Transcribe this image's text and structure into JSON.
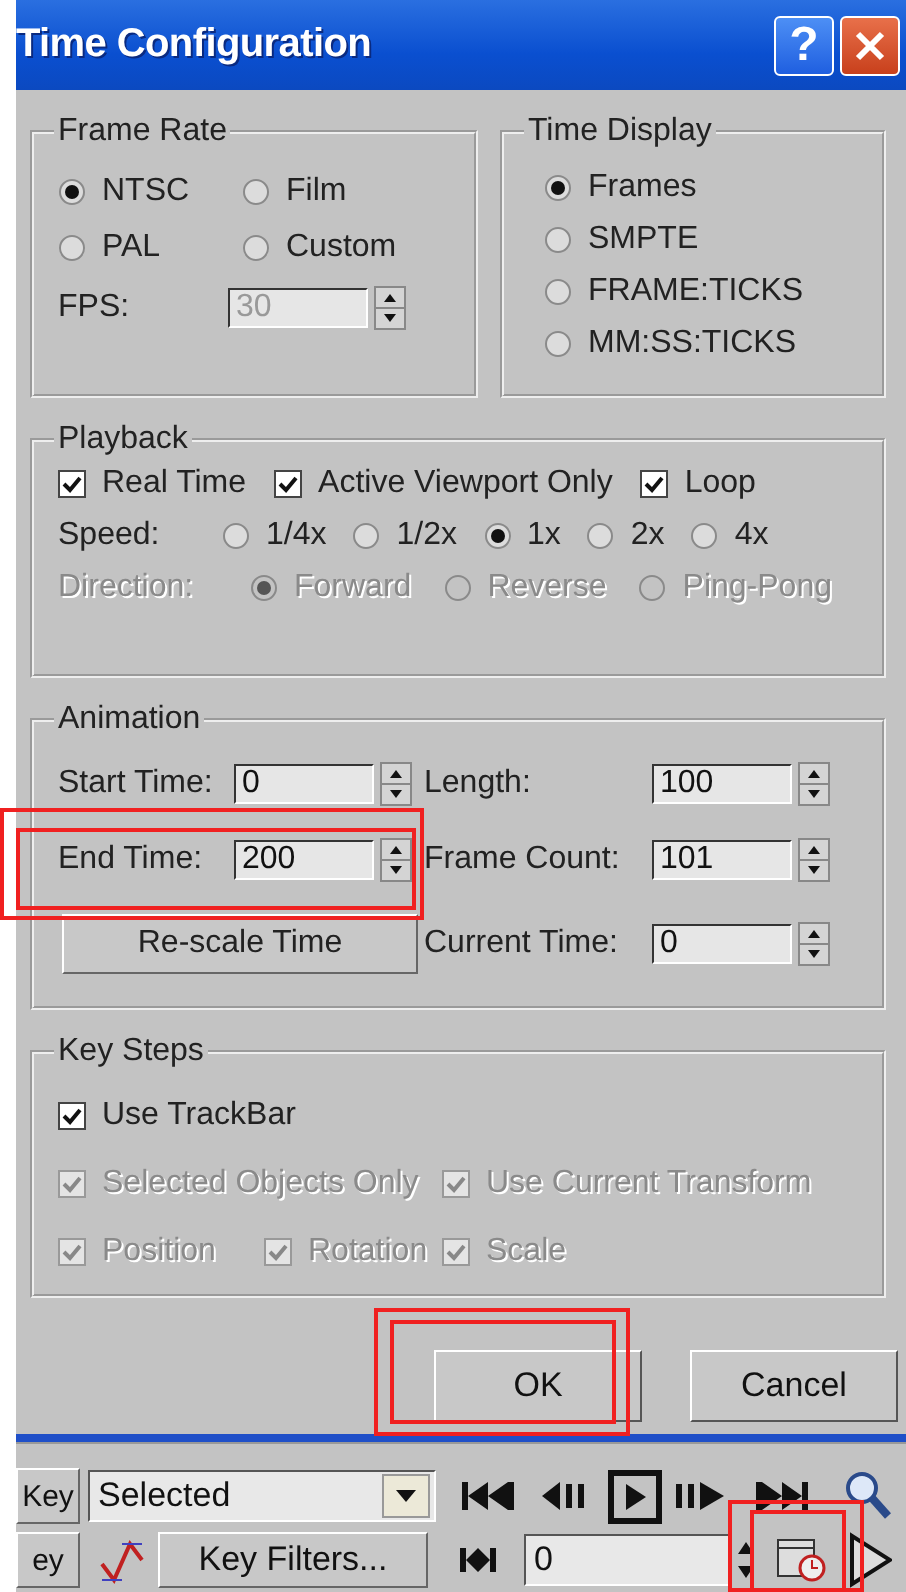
{
  "window": {
    "title": "Time Configuration",
    "help_button": "?"
  },
  "frame_rate": {
    "label": "Frame Rate",
    "options": [
      {
        "label": "NTSC",
        "selected": true
      },
      {
        "label": "Film",
        "selected": false
      },
      {
        "label": "PAL",
        "selected": false
      },
      {
        "label": "Custom",
        "selected": false
      }
    ],
    "fps_label": "FPS:",
    "fps_value": "30",
    "fps_disabled": true
  },
  "time_display": {
    "label": "Time Display",
    "options": [
      {
        "label": "Frames",
        "selected": true
      },
      {
        "label": "SMPTE",
        "selected": false
      },
      {
        "label": "FRAME:TICKS",
        "selected": false
      },
      {
        "label": "MM:SS:TICKS",
        "selected": false
      }
    ]
  },
  "playback": {
    "label": "Playback",
    "checks": [
      {
        "label": "Real Time",
        "checked": true
      },
      {
        "label": "Active Viewport Only",
        "checked": true
      },
      {
        "label": "Loop",
        "checked": true
      }
    ],
    "speed_label": "Speed:",
    "speeds": [
      {
        "label": "1/4x",
        "selected": false
      },
      {
        "label": "1/2x",
        "selected": false
      },
      {
        "label": "1x",
        "selected": true
      },
      {
        "label": "2x",
        "selected": false
      },
      {
        "label": "4x",
        "selected": false
      }
    ],
    "direction_label": "Direction:",
    "direction_disabled": true,
    "directions": [
      {
        "label": "Forward",
        "selected": true
      },
      {
        "label": "Reverse",
        "selected": false
      },
      {
        "label": "Ping-Pong",
        "selected": false
      }
    ]
  },
  "animation": {
    "label": "Animation",
    "fields": [
      {
        "label": "Start Time:",
        "value": "0"
      },
      {
        "label": "Length:",
        "value": "100"
      },
      {
        "label": "End Time:",
        "value": "200"
      },
      {
        "label": "Frame Count:",
        "value": "101"
      },
      {
        "label": "Current Time:",
        "value": "0"
      }
    ],
    "rescale_button": "Re-scale Time"
  },
  "key_steps": {
    "label": "Key Steps",
    "checks": [
      {
        "label": "Use TrackBar",
        "checked": true,
        "disabled": false
      },
      {
        "label": "Selected Objects Only",
        "checked": true,
        "disabled": true
      },
      {
        "label": "Use Current Transform",
        "checked": true,
        "disabled": true
      },
      {
        "label": "Position",
        "checked": true,
        "disabled": true
      },
      {
        "label": "Rotation",
        "checked": true,
        "disabled": true
      },
      {
        "label": "Scale",
        "checked": true,
        "disabled": true
      }
    ]
  },
  "buttons": [
    {
      "label": "OK"
    },
    {
      "label": "Cancel"
    }
  ],
  "toolbar": {
    "key_buttons": [
      "Key",
      "ey"
    ],
    "selection_dropdown": "Selected",
    "key_filters_button": "Key Filters...",
    "frame_field": "0"
  }
}
